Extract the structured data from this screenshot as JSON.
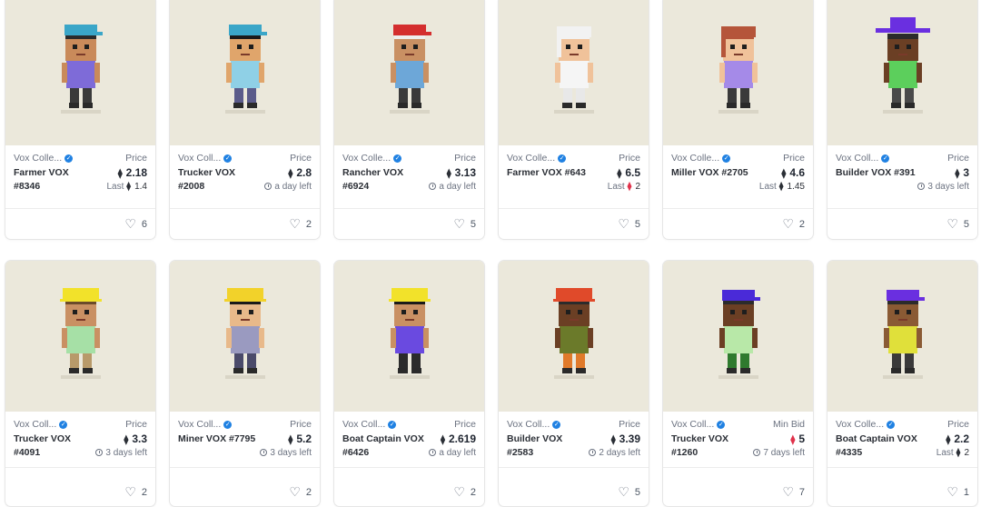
{
  "collection": "Vox Collectibles",
  "cards": [
    {
      "collection": "Vox Colle...",
      "name": "Farmer VOX #8346",
      "price_label": "Price",
      "price": "2.18",
      "eth_icon": "eth-icon",
      "sub_type": "last",
      "sub_value": "1.4",
      "likes": "6",
      "skin": "#c98a5a",
      "hat": "#3aa6c8",
      "hat_style": "cap",
      "shirt": "#7e6bd8",
      "pants": "#3a3a3a",
      "hair": "#2b2b2b"
    },
    {
      "collection": "Vox Coll...",
      "name": "Trucker VOX #2008",
      "price_label": "Price",
      "price": "2.8",
      "sub_type": "time",
      "sub_value": "a day left",
      "likes": "2",
      "skin": "#e0a56b",
      "hat": "#3aa6c8",
      "hat_style": "cap",
      "shirt": "#8fd0e6",
      "pants": "#5b5b8a",
      "hair": "#1a1a1a"
    },
    {
      "collection": "Vox Colle...",
      "name": "Rancher VOX #6924",
      "price_label": "Price",
      "price": "3.13",
      "sub_type": "time",
      "sub_value": "a day left",
      "likes": "5",
      "skin": "#c99063",
      "hat": "#d42e2e",
      "hat_style": "cap",
      "shirt": "#6da7d8",
      "pants": "#3a3a3a",
      "hair": "#eeeeee"
    },
    {
      "collection": "Vox Colle...",
      "name": "Farmer VOX #643",
      "price_label": "Price",
      "price": "6.5",
      "sub_type": "last_red",
      "sub_value": "2",
      "likes": "5",
      "skin": "#f0c29a",
      "hat": "#f2f2f2",
      "hat_style": "hair",
      "shirt": "#f5f5f5",
      "pants": "#e8e8e8",
      "hair": "#f2f2f2"
    },
    {
      "collection": "Vox Colle...",
      "name": "Miller VOX #2705",
      "price_label": "Price",
      "price": "4.6",
      "sub_type": "last",
      "sub_value": "1.45",
      "likes": "2",
      "skin": "#f0c29a",
      "hat": "#b5553a",
      "hat_style": "hair",
      "shirt": "#a58ae8",
      "pants": "#3a3a3a",
      "hair": "#b5553a"
    },
    {
      "collection": "Vox Coll...",
      "name": "Builder VOX #391",
      "price_label": "Price",
      "price": "3",
      "sub_type": "time",
      "sub_value": "3 days left",
      "likes": "5",
      "skin": "#6b3f24",
      "hat": "#6a2fe0",
      "hat_style": "wide",
      "shirt": "#5ccf5c",
      "pants": "#4a4a4a",
      "hair": "#2b2b2b"
    },
    {
      "collection": "Vox Coll...",
      "name": "Trucker VOX #4091",
      "price_label": "Price",
      "price": "3.3",
      "sub_type": "time",
      "sub_value": "3 days left",
      "likes": "2",
      "skin": "#c99063",
      "hat": "#f2e22a",
      "hat_style": "hard",
      "shirt": "#a6e0a6",
      "pants": "#b89a6a",
      "hair": "#6b4a2b"
    },
    {
      "collection": "Vox Coll...",
      "name": "Miner VOX #7795",
      "price_label": "Price",
      "price": "5.2",
      "sub_type": "time",
      "sub_value": "3 days left",
      "likes": "2",
      "skin": "#e8b98a",
      "hat": "#f2d22a",
      "hat_style": "hard",
      "shirt": "#9a9ac0",
      "pants": "#4a4a6a",
      "hair": "#1a1a1a"
    },
    {
      "collection": "Vox Coll...",
      "name": "Boat Captain VOX #6426",
      "price_label": "Price",
      "price": "2.619",
      "sub_type": "time",
      "sub_value": "a day left",
      "likes": "2",
      "skin": "#c99063",
      "hat": "#f2e22a",
      "hat_style": "hard",
      "shirt": "#6a4ae0",
      "pants": "#2b2b2b",
      "hair": "#1a1a1a"
    },
    {
      "collection": "Vox Coll...",
      "name": "Builder VOX #2583",
      "price_label": "Price",
      "price": "3.39",
      "sub_type": "time",
      "sub_value": "2 days left",
      "likes": "5",
      "skin": "#6b3f24",
      "hat": "#e04a2a",
      "hat_style": "hard",
      "shirt": "#6b7a2a",
      "pants": "#e07a2a",
      "hair": "#2b2b2b"
    },
    {
      "collection": "Vox Coll...",
      "name": "Trucker VOX #1260",
      "price_label": "Min Bid",
      "price": "5",
      "eth_red": true,
      "sub_type": "time",
      "sub_value": "7 days left",
      "likes": "7",
      "skin": "#6b3f24",
      "hat": "#4a2ad8",
      "hat_style": "cap",
      "shirt": "#b8e8a8",
      "pants": "#2f7a2f",
      "hair": "#2b2b2b"
    },
    {
      "collection": "Vox Colle...",
      "name": "Boat Captain VOX #4335",
      "price_label": "Price",
      "price": "2.2",
      "sub_type": "last",
      "sub_value": "2",
      "likes": "1",
      "skin": "#8a5a34",
      "hat": "#6a2fe0",
      "hat_style": "cap",
      "shirt": "#e0e03a",
      "pants": "#3a3a3a",
      "hair": "#2b2b2b"
    }
  ]
}
